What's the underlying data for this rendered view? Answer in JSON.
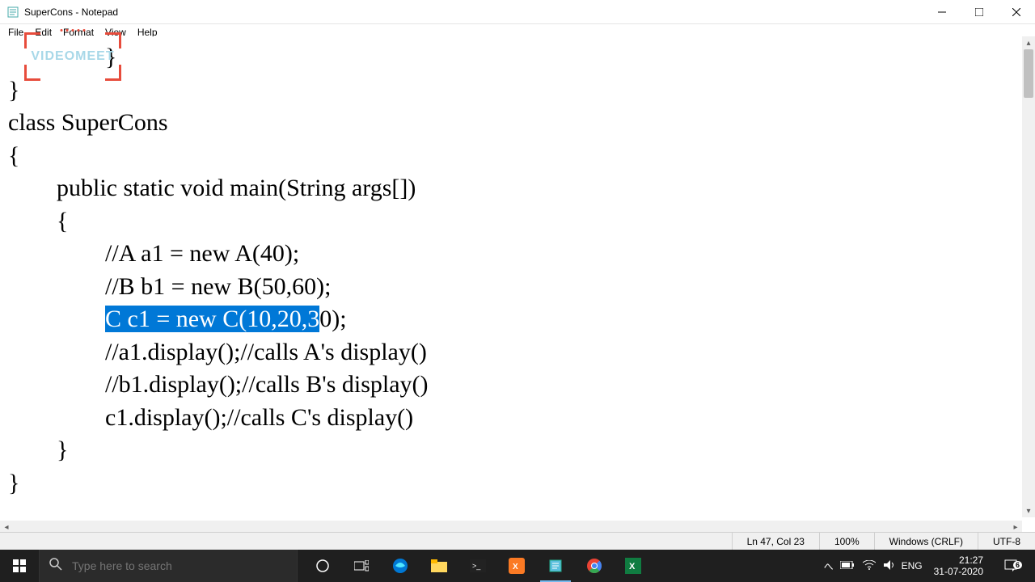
{
  "window": {
    "title": "SuperCons - Notepad",
    "minimize": "—",
    "maximize": "▢",
    "close": "✕"
  },
  "menu": {
    "file": "File",
    "edit": "Edit",
    "format": "Format",
    "view": "View",
    "help": "Help"
  },
  "watermark": {
    "text": "VIDEOMEET"
  },
  "code": {
    "l1": "\t\t}",
    "l2": "}",
    "l3": "class SuperCons",
    "l4": "{",
    "l5": "\tpublic static void main(String args[])",
    "l6": "\t{",
    "l7": "\t\t//A a1 = new A(40);",
    "l8": "\t\t//B b1 = new B(50,60);",
    "l9pre": "\t\t",
    "l9sel": "C c1 = new C(10,20,3",
    "l9post": "0);",
    "l10": "\t\t//a1.display();//calls A's display()",
    "l11": "\t\t//b1.display();//calls B's display()",
    "l12": "\t\tc1.display();//calls C's display()",
    "l13": "\t}",
    "l14": "}"
  },
  "status": {
    "position": "Ln 47, Col 23",
    "zoom": "100%",
    "lineending": "Windows (CRLF)",
    "encoding": "UTF-8"
  },
  "taskbar": {
    "search_placeholder": "Type here to search",
    "lang": "ENG",
    "time": "21:27",
    "date": "31-07-2020",
    "notif_count": "6"
  }
}
